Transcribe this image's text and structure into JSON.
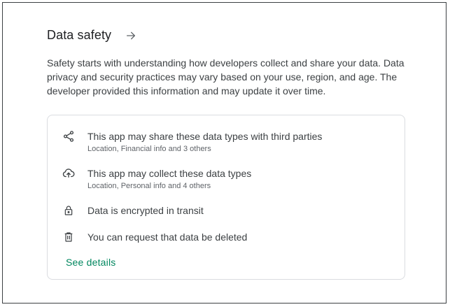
{
  "section": {
    "title": "Data safety",
    "description": "Safety starts with understanding how developers collect and share your data. Data privacy and security practices may vary based on your use, region, and age. The developer provided this information and may update it over time."
  },
  "card": {
    "items": [
      {
        "icon": "share-icon",
        "title": "This app may share these data types with third parties",
        "subtitle": "Location, Financial info and 3 others"
      },
      {
        "icon": "cloud-upload-icon",
        "title": "This app may collect these data types",
        "subtitle": "Location, Personal info and 4 others"
      },
      {
        "icon": "lock-icon",
        "title": "Data is encrypted in transit"
      },
      {
        "icon": "trash-icon",
        "title": "You can request that data be deleted"
      }
    ],
    "see_details": "See details"
  },
  "colors": {
    "link": "#01875f",
    "text": "#202124",
    "secondary_text": "#5f6368",
    "border": "#dadce0"
  }
}
